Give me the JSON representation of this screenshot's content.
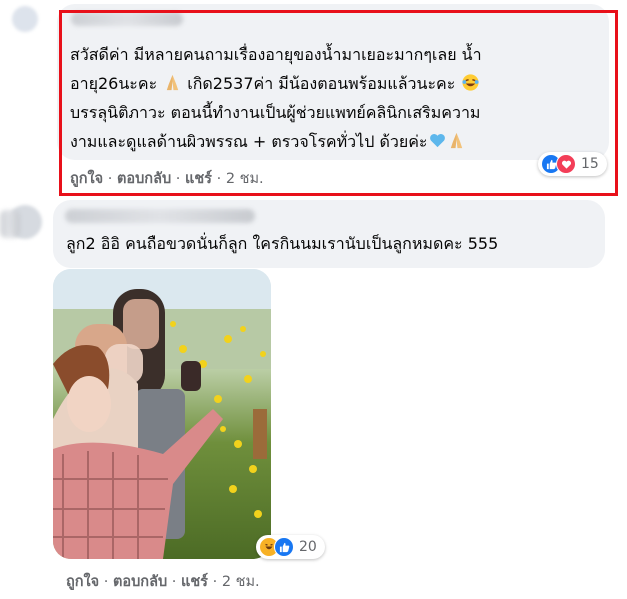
{
  "comments": [
    {
      "text_lines": [
        "สวัสดีค่า มีหลายคนถามเรื่องอายุของน้ำมาเยอะมากๆเลย น้ำ",
        "อายุ26นะคะ",
        " เกิด2537ค่า มีน้องตอนพร้อมแล้วนะคะ",
        "บรรลุนิติภาวะ ตอนนี้ทำงานเป็นผู้ช่วยแพทย์คลินิกเสริมความ",
        "งามและดูแลด้านผิวพรรณ + ตรวจโรคทั่วไป ด้วยค่ะ"
      ],
      "emojis": [
        "folded-hands",
        "laughing-tears",
        "blue-heart",
        "folded-hands"
      ],
      "actions": {
        "like": "ถูกใจ",
        "sep": "·",
        "reply": "ตอบกลับ",
        "share": "แชร์",
        "time": "2 ชม."
      },
      "reactions": {
        "types": [
          "like",
          "love"
        ],
        "count": "15",
        "colors": {
          "like": "#1877f2",
          "love": "#f33e58"
        }
      }
    },
    {
      "text": "ลูก2 อิอิ คนถือขวดนั่นก็ลูก ใครกินนมเรานับเป็นลูกหมดคะ 555",
      "reactions": {
        "types": [
          "haha",
          "like"
        ],
        "count": "20",
        "colors": {
          "haha": "#f7b125",
          "like": "#1877f2"
        }
      },
      "actions": {
        "like": "ถูกใจ",
        "sep": "·",
        "reply": "ตอบกลับ",
        "share": "แชร์",
        "time": "2 ชม."
      }
    }
  ],
  "highlight_color": "#e8101a"
}
